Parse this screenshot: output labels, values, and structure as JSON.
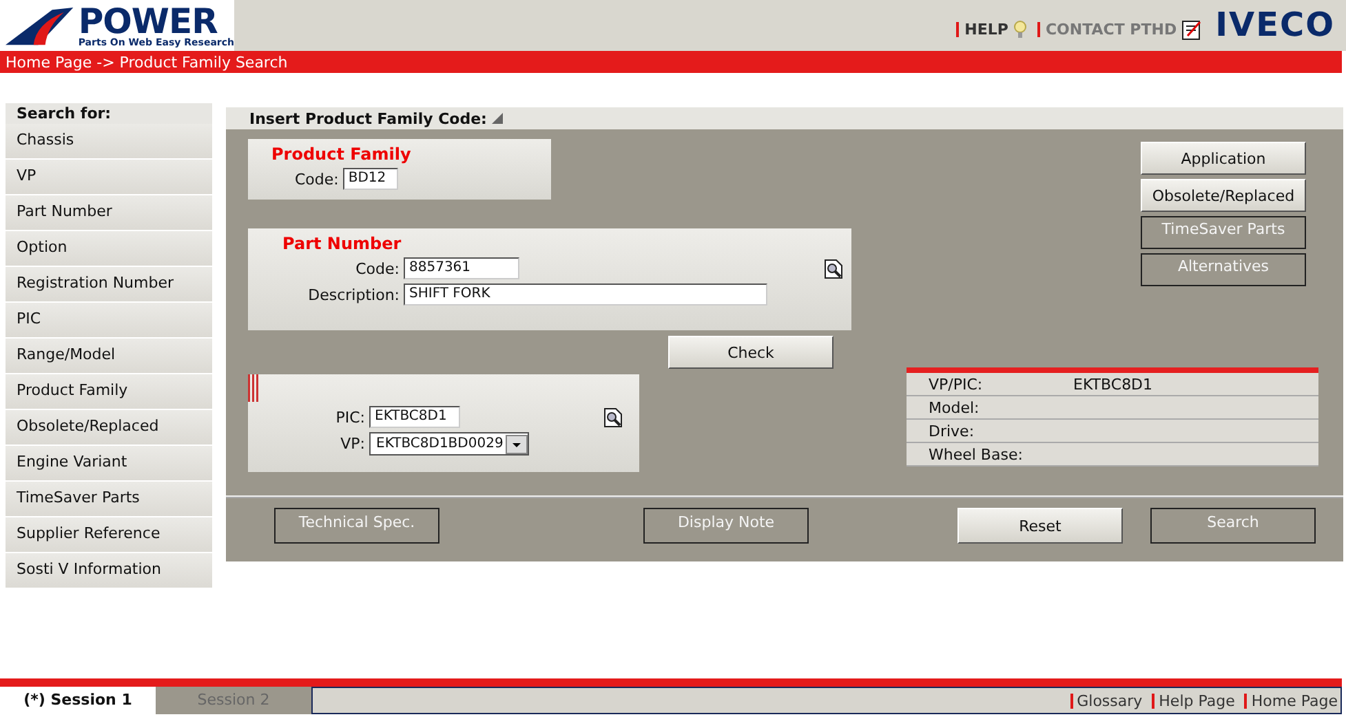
{
  "header": {
    "logo": "POWER",
    "tagline": "Parts On Web Easy Research",
    "links": [
      {
        "label": "HELP",
        "kind": "help",
        "disabled": false
      },
      {
        "label": "CONTACT PTHD",
        "kind": "contact",
        "disabled": true
      }
    ],
    "brand": "IVECO"
  },
  "breadcrumb": "Home Page -> Product Family Search",
  "sidebar": {
    "title": "Search for:",
    "items": [
      {
        "label": "Chassis"
      },
      {
        "label": "VP"
      },
      {
        "label": "Part Number"
      },
      {
        "label": "Option"
      },
      {
        "label": "Registration Number"
      },
      {
        "label": "PIC"
      },
      {
        "label": "Range/Model"
      },
      {
        "label": "Product Family"
      },
      {
        "label": "Obsolete/Replaced"
      },
      {
        "label": "Engine Variant"
      },
      {
        "label": "TimeSaver Parts"
      },
      {
        "label": "Supplier Reference"
      },
      {
        "label": "Sosti V Information"
      }
    ]
  },
  "form": {
    "title": "Insert Product Family Code:",
    "product_family": {
      "title": "Product Family",
      "code_label": "Code:",
      "code": "BD12"
    },
    "part_number": {
      "title": "Part Number",
      "code_label": "Code:",
      "code": "8857361",
      "description_label": "Description:",
      "description": "SHIFT FORK"
    },
    "check_button": "Check",
    "vehicle": {
      "pic_label": "PIC:",
      "pic": "EKTBC8D1",
      "vp_label": "VP:",
      "vp": "EKTBC8D1BD0029"
    },
    "side_buttons": [
      {
        "label": "Application",
        "disabled": false
      },
      {
        "label": "Obsolete/Replaced",
        "disabled": false
      },
      {
        "label": "TimeSaver Parts",
        "disabled": true
      },
      {
        "label": "Alternatives",
        "disabled": true
      }
    ],
    "info": [
      {
        "label": "VP/PIC:",
        "value": "EKTBC8D1"
      },
      {
        "label": "Model:"
      },
      {
        "label": "Drive:"
      },
      {
        "label": "Wheel Base:"
      }
    ],
    "bottom_buttons": [
      {
        "label": "Technical Spec.",
        "disabled": true
      },
      {
        "label": "Display Note",
        "disabled": true
      },
      {
        "label": "Reset",
        "disabled": false
      },
      {
        "label": "Search",
        "disabled": true
      }
    ]
  },
  "sessions": [
    {
      "label": "(*) Session 1",
      "selected": true
    },
    {
      "label": "Session 2",
      "selected": false
    }
  ],
  "footer_links": [
    "Glossary",
    "Help Page",
    "Home Page"
  ]
}
